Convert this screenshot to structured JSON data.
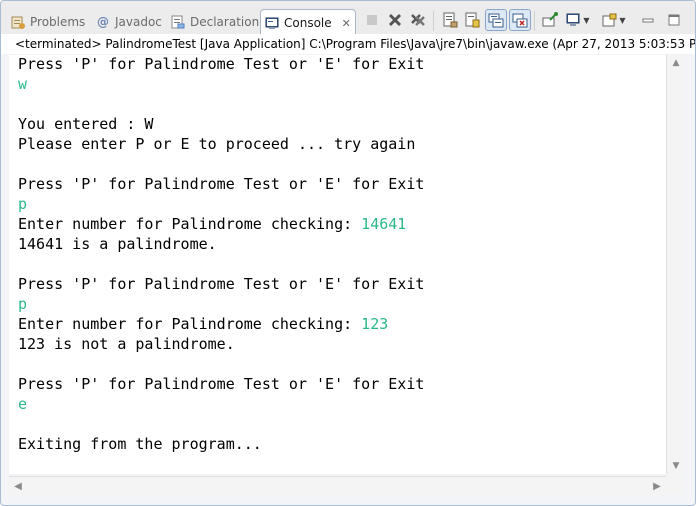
{
  "tabs": [
    {
      "label": "Problems",
      "icon": "problems-icon"
    },
    {
      "label": "Javadoc",
      "icon": "javadoc-icon"
    },
    {
      "label": "Declaration",
      "icon": "declaration-icon"
    },
    {
      "label": "Console",
      "icon": "console-icon",
      "active": true
    }
  ],
  "toolbar": [
    "terminate-icon",
    "remove-launch-icon",
    "remove-all-terminated-icon",
    "clear-console-icon",
    "scroll-lock-icon",
    "show-on-stdout-icon",
    "show-on-stderr-icon",
    "pin-console-icon",
    "display-console-icon",
    "open-console-icon",
    "minimize-icon",
    "maximize-icon"
  ],
  "status": "<terminated> PalindromeTest [Java Application] C:\\Program Files\\Java\\jre7\\bin\\javaw.exe (Apr 27, 2013 5:03:53 P",
  "console": {
    "l1": "Press 'P' for Palindrome Test or 'E' for Exit",
    "l2": "w",
    "l4": "You entered : W",
    "l5": "Please enter P or E to proceed ... try again",
    "l7": "Press 'P' for Palindrome Test or 'E' for Exit",
    "l8": "p",
    "l9_prompt": "Enter number for Palindrome checking: ",
    "l9_input": "14641",
    "l10": "14641 is a palindrome.",
    "l12": "Press 'P' for Palindrome Test or 'E' for Exit",
    "l13": "p",
    "l14_prompt": "Enter number for Palindrome checking: ",
    "l14_input": "123",
    "l15": "123 is not a palindrome.",
    "l17": "Press 'P' for Palindrome Test or 'E' for Exit",
    "l18": "e",
    "l20": "Exiting from the program..."
  },
  "colors": {
    "input_text": "#2bb88a",
    "output_text": "#000000"
  }
}
